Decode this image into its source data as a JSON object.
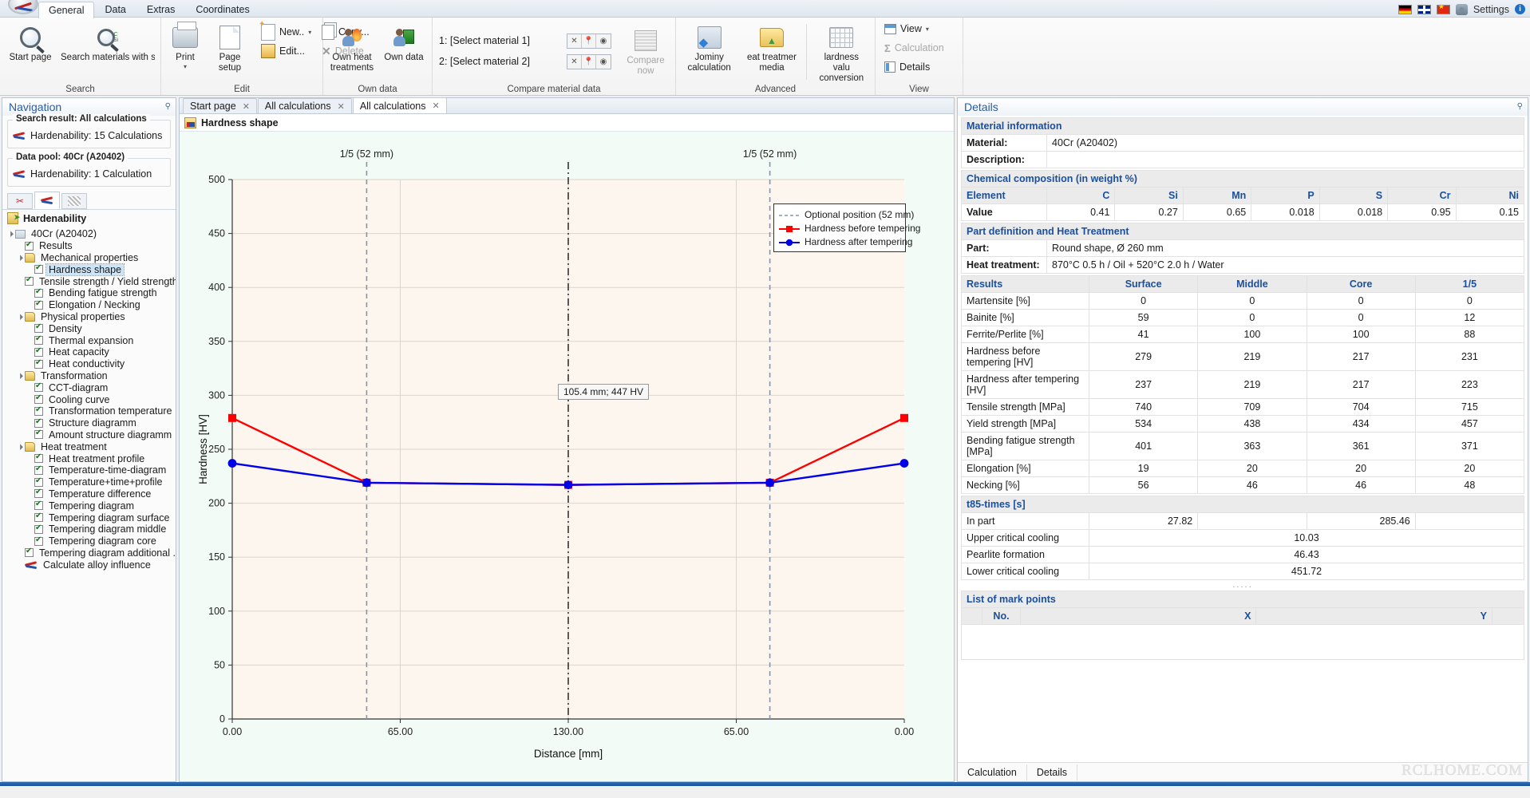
{
  "app": {
    "tabs": [
      "General",
      "Data",
      "Extras",
      "Coordinates"
    ],
    "active_tab": "General",
    "settings_label": "Settings",
    "info_label": "i",
    "flags": [
      "flag-de-icon",
      "flag-uk-icon",
      "flag-cn-icon"
    ]
  },
  "ribbon": {
    "groups": [
      {
        "title": "Search",
        "buttons": [
          {
            "label": "Start page",
            "icon": "magnifier-icon"
          },
          {
            "label": "Search materials with similar analysis",
            "icon": "magnifier-analysis-icon"
          }
        ]
      },
      {
        "title": "Edit",
        "buttons": [
          {
            "label": "Print",
            "icon": "printer-icon"
          },
          {
            "label": "Page setup",
            "icon": "page-setup-icon"
          }
        ],
        "small_buttons": [
          {
            "label": "New..",
            "icon": "new-document-icon",
            "has_caret": true,
            "disabled": false
          },
          {
            "label": "Copy...",
            "icon": "copy-icon",
            "disabled": false
          },
          {
            "label": "Edit...",
            "icon": "edit-icon",
            "disabled": false
          },
          {
            "label": "Delete",
            "icon": "delete-x-icon",
            "disabled": true
          }
        ]
      },
      {
        "title": "Own data",
        "buttons": [
          {
            "label": "Own heat treatments",
            "icon": "own-heat-treatment-icon"
          },
          {
            "label": "Own data",
            "icon": "own-data-icon"
          }
        ]
      },
      {
        "title": "Compare material data",
        "rows": [
          {
            "label": "1: [Select material 1]"
          },
          {
            "label": "2: [Select material 2]"
          }
        ],
        "mini_buttons": [
          "x",
          "pin",
          "eye"
        ],
        "compare_button": "Compare now"
      },
      {
        "title": "Advanced",
        "buttons": [
          {
            "label": "Jominy calculation",
            "icon": "jominy-icon"
          },
          {
            "label": "eat treatmer media",
            "icon": "heat-treatment-media-icon"
          },
          {
            "label": "lardness valu conversion",
            "icon": "hardness-conversion-icon"
          }
        ]
      },
      {
        "title": "View",
        "small_buttons": [
          {
            "label": "View",
            "icon": "view-icon",
            "has_caret": true,
            "disabled": false
          },
          {
            "label": "Calculation",
            "icon": "sigma-icon",
            "disabled": true
          },
          {
            "label": "Details",
            "icon": "details-icon",
            "disabled": false
          }
        ]
      }
    ]
  },
  "navigation": {
    "title": "Navigation",
    "search_result": {
      "legend": "Search result: All calculations",
      "item": "Hardenability: 15 Calculations"
    },
    "data_pool": {
      "legend": "Data pool: 40Cr (A20402)",
      "item": "Hardenability: 1 Calculation"
    },
    "nav_tabs": [
      "scissors-tab",
      "hardenability-tab",
      "hatch-tab"
    ],
    "tree_title": "Hardenability",
    "tree": [
      {
        "label": "40Cr (A20402)",
        "level": 0,
        "type": "calc",
        "expander": true
      },
      {
        "label": "Results",
        "level": 1,
        "type": "check"
      },
      {
        "label": "Mechanical properties",
        "level": 1,
        "type": "folder",
        "expander": true
      },
      {
        "label": "Hardness shape",
        "level": 2,
        "type": "check",
        "selected": true
      },
      {
        "label": "Tensile strength / Yield strength",
        "level": 2,
        "type": "check"
      },
      {
        "label": "Bending fatigue strength",
        "level": 2,
        "type": "check"
      },
      {
        "label": "Elongation / Necking",
        "level": 2,
        "type": "check"
      },
      {
        "label": "Physical properties",
        "level": 1,
        "type": "folder",
        "expander": true
      },
      {
        "label": "Density",
        "level": 2,
        "type": "check"
      },
      {
        "label": "Thermal expansion",
        "level": 2,
        "type": "check"
      },
      {
        "label": "Heat capacity",
        "level": 2,
        "type": "check"
      },
      {
        "label": "Heat conductivity",
        "level": 2,
        "type": "check"
      },
      {
        "label": "Transformation",
        "level": 1,
        "type": "folder",
        "expander": true
      },
      {
        "label": "CCT-diagram",
        "level": 2,
        "type": "check"
      },
      {
        "label": "Cooling curve",
        "level": 2,
        "type": "check"
      },
      {
        "label": "Transformation temperature",
        "level": 2,
        "type": "check"
      },
      {
        "label": "Structure diagramm",
        "level": 2,
        "type": "check"
      },
      {
        "label": "Amount structure diagramm",
        "level": 2,
        "type": "check"
      },
      {
        "label": "Heat treatment",
        "level": 1,
        "type": "folder",
        "expander": true
      },
      {
        "label": "Heat treatment profile",
        "level": 2,
        "type": "check"
      },
      {
        "label": "Temperature-time-diagram",
        "level": 2,
        "type": "check"
      },
      {
        "label": "Temperature+time+profile",
        "level": 2,
        "type": "check"
      },
      {
        "label": "Temperature difference",
        "level": 2,
        "type": "check"
      },
      {
        "label": "Tempering diagram",
        "level": 2,
        "type": "check"
      },
      {
        "label": "Tempering diagram surface",
        "level": 2,
        "type": "check"
      },
      {
        "label": "Tempering diagram middle",
        "level": 2,
        "type": "check"
      },
      {
        "label": "Tempering diagram core",
        "level": 2,
        "type": "check"
      },
      {
        "label": "Tempering diagram additional ...",
        "level": 2,
        "type": "check"
      },
      {
        "label": "Calculate alloy influence",
        "level": 1,
        "type": "alloy"
      }
    ]
  },
  "center": {
    "doc_tabs": [
      {
        "label": "Start page",
        "closable": true,
        "active": false
      },
      {
        "label": "All calculations",
        "closable": true,
        "active": false
      },
      {
        "label": "All calculations",
        "closable": true,
        "active": true
      }
    ],
    "doc_title": "Hardness shape"
  },
  "chart_data": {
    "type": "line",
    "title": "Hardness shape",
    "xlabel": "Distance [mm]",
    "ylabel": "Hardness [HV]",
    "xlim": [
      0,
      260
    ],
    "ylim": [
      0,
      500
    ],
    "yticks": [
      0,
      50,
      100,
      150,
      200,
      250,
      300,
      350,
      400,
      450,
      500
    ],
    "xticks": [
      0,
      65,
      130,
      195,
      260
    ],
    "xticklabels": [
      "0.00",
      "65.00",
      "130.00",
      "65.00",
      "0.00"
    ],
    "grid": true,
    "legend_position": "top-right",
    "legend": [
      {
        "name": "Optional position (52 mm)",
        "color": "#8a93a5",
        "style": "dashed"
      },
      {
        "name": "Hardness before tempering",
        "color": "#ff0000",
        "style": "line-marker-square"
      },
      {
        "name": "Hardness after tempering",
        "color": "#0000e6",
        "style": "line-marker-circle"
      }
    ],
    "series": [
      {
        "name": "Hardness before tempering",
        "color": "#ff0000",
        "marker": "square",
        "x": [
          0,
          52,
          130,
          208,
          260
        ],
        "y": [
          279,
          219,
          217,
          219,
          279
        ]
      },
      {
        "name": "Hardness after tempering",
        "color": "#0000e6",
        "marker": "circle",
        "x": [
          0,
          52,
          130,
          208,
          260
        ],
        "y": [
          237,
          219,
          217,
          219,
          237
        ]
      }
    ],
    "vlines": [
      {
        "x": 52,
        "label": "1/5 (52 mm)",
        "color": "#8a93a5",
        "style": "dashed"
      },
      {
        "x": 130,
        "label": "",
        "color": "#333333",
        "style": "dashdot"
      },
      {
        "x": 208,
        "label": "1/5 (52 mm)",
        "color": "#8a93a5",
        "style": "dashed"
      }
    ],
    "annotations": [
      {
        "text_bold": "105.4 mm; 447 HV",
        "x": 130,
        "y": 390
      }
    ],
    "tooltip": {
      "value": "105.4 mm",
      "unit_sep": "; ",
      "hv": "447 HV",
      "full": "105.4 mm; 447 HV"
    }
  },
  "details": {
    "title": "Details",
    "material_information": {
      "section": "Material information",
      "rows": [
        {
          "label": "Material:",
          "value": "40Cr (A20402)"
        },
        {
          "label": "Description:",
          "value": ""
        }
      ]
    },
    "chemical_composition": {
      "section": "Chemical composition  (in weight %)",
      "header": [
        "Element",
        "C",
        "Si",
        "Mn",
        "P",
        "S",
        "Cr",
        "Ni"
      ],
      "values": [
        "Value",
        "0.41",
        "0.27",
        "0.65",
        "0.018",
        "0.018",
        "0.95",
        "0.15"
      ]
    },
    "part_definition": {
      "section": "Part definition  and Heat Treatment",
      "rows": [
        {
          "label": "Part:",
          "value": "Round shape, Ø 260 mm"
        },
        {
          "label": "Heat treatment:",
          "value": "870°C 0.5 h / Oil + 520°C 2.0 h / Water"
        }
      ]
    },
    "results": {
      "header": [
        "Results",
        "Surface",
        "Middle",
        "Core",
        "1/5"
      ],
      "rows": [
        {
          "label": "Martensite [%]",
          "values": [
            "0",
            "0",
            "0",
            "0"
          ]
        },
        {
          "label": "Bainite [%]",
          "values": [
            "59",
            "0",
            "0",
            "12"
          ]
        },
        {
          "label": "Ferrite/Perlite [%]",
          "values": [
            "41",
            "100",
            "100",
            "88"
          ]
        },
        {
          "label": "Hardness before tempering [HV]",
          "values": [
            "279",
            "219",
            "217",
            "231"
          ]
        },
        {
          "label": "Hardness after tempering [HV]",
          "values": [
            "237",
            "219",
            "217",
            "223"
          ]
        },
        {
          "label": "Tensile strength [MPa]",
          "values": [
            "740",
            "709",
            "704",
            "715"
          ]
        },
        {
          "label": "Yield strength [MPa]",
          "values": [
            "534",
            "438",
            "434",
            "457"
          ]
        },
        {
          "label": "Bending fatigue strength [MPa]",
          "values": [
            "401",
            "363",
            "361",
            "371"
          ]
        },
        {
          "label": "Elongation [%]",
          "values": [
            "19",
            "20",
            "20",
            "20"
          ]
        },
        {
          "label": "Necking [%]",
          "values": [
            "56",
            "46",
            "46",
            "48"
          ]
        }
      ]
    },
    "t85": {
      "section": "t85-times [s]",
      "rows": [
        {
          "label": "In part",
          "values": [
            "27.82",
            "",
            "285.46",
            ""
          ],
          "span": false
        },
        {
          "label": "Upper critical cooling",
          "value": "10.03",
          "span": true
        },
        {
          "label": "Pearlite formation",
          "value": "46.43",
          "span": true
        },
        {
          "label": "Lower critical cooling",
          "value": "451.72",
          "span": true
        }
      ]
    },
    "mark_points": {
      "separator": ".....",
      "section": "List of mark points",
      "header": [
        "",
        "No.",
        "X",
        "Y",
        ""
      ]
    },
    "footer_tabs": [
      "Calculation",
      "Details"
    ],
    "watermark": "RCLHOME.COM"
  }
}
